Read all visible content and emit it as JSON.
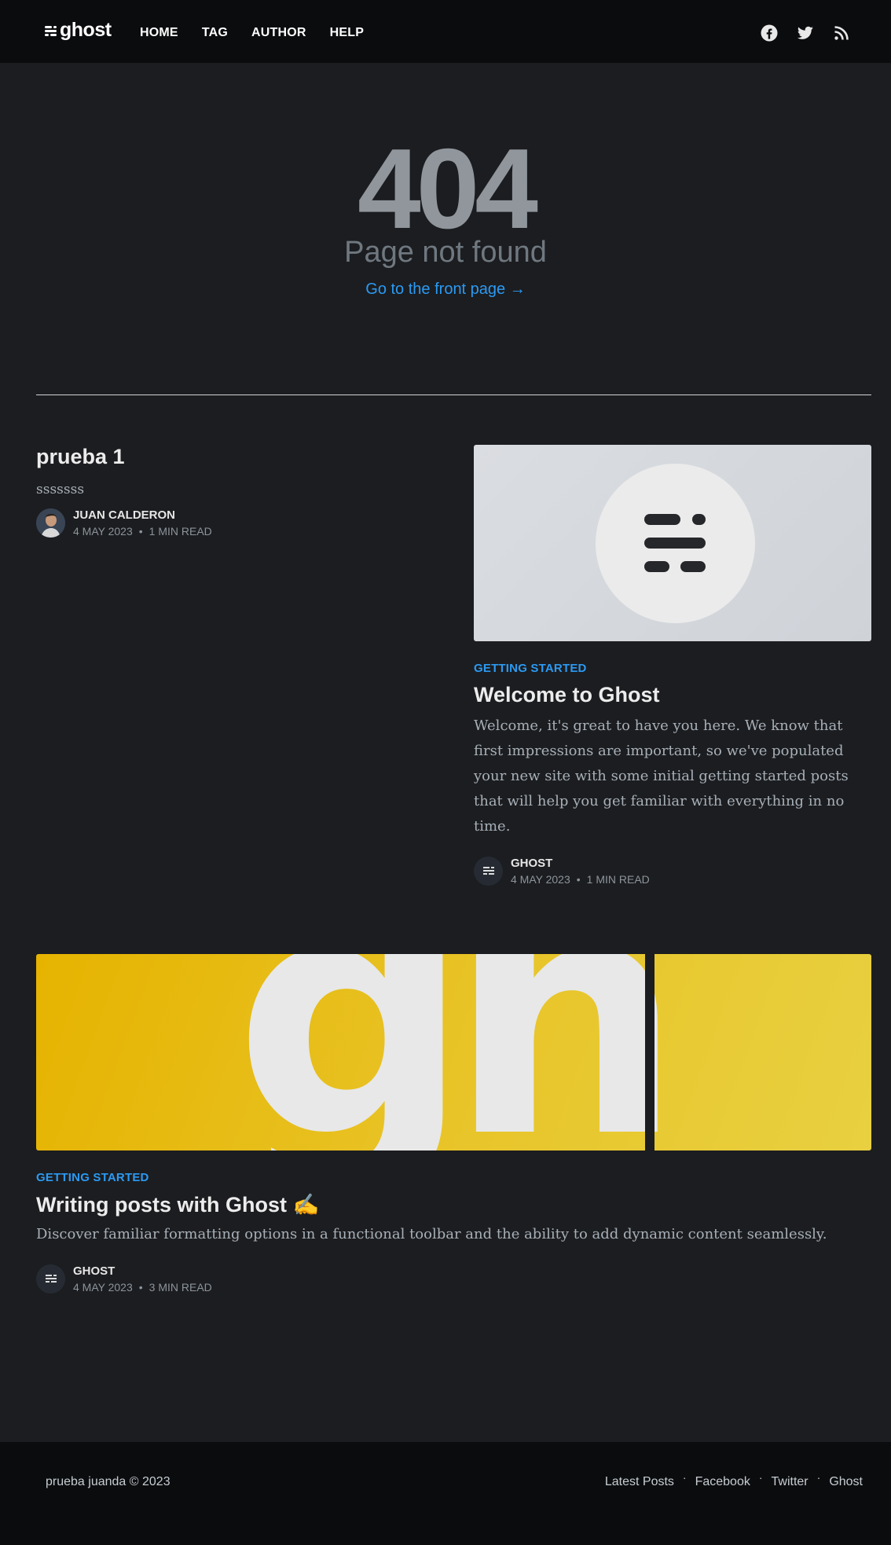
{
  "header": {
    "logo_text": "ghost",
    "nav": [
      {
        "label": "HOME"
      },
      {
        "label": "TAG"
      },
      {
        "label": "AUTHOR"
      },
      {
        "label": "HELP"
      }
    ],
    "social": [
      "facebook-icon",
      "twitter-icon",
      "rss-icon"
    ]
  },
  "error": {
    "code": "404",
    "description": "Page not found",
    "link": "Go to the front page →"
  },
  "posts": [
    {
      "title": "prueba 1",
      "excerpt": "sssssss",
      "author": "JUAN CALDERON",
      "date": "4 MAY 2023",
      "read_time": "1 MIN READ"
    },
    {
      "tag": "GETTING STARTED",
      "title": "Welcome to Ghost",
      "excerpt": "Welcome, it's great to have you here. We know that first impressions are important, so we've populated your new site with some initial getting started posts that will help you get familiar with everything in no time.",
      "author": "GHOST",
      "date": "4 MAY 2023",
      "read_time": "1 MIN READ"
    },
    {
      "tag": "GETTING STARTED",
      "title": "Writing posts with Ghost ✍️",
      "excerpt": "Discover familiar formatting options in a functional toolbar and the ability to add dynamic content seamlessly.",
      "author": "GHOST",
      "date": "4 MAY 2023",
      "read_time": "3 MIN READ",
      "image_text": "gh"
    }
  ],
  "footer": {
    "copyright": "prueba juanda © 2023",
    "links": [
      "Latest Posts",
      "Facebook",
      "Twitter",
      "Ghost"
    ],
    "separator": "·"
  },
  "colors": {
    "background": "#1c1d20",
    "header": "#0b0c0e",
    "accent": "#2b9af3",
    "error_code": "#90969c",
    "yellow": "#e8c020"
  }
}
